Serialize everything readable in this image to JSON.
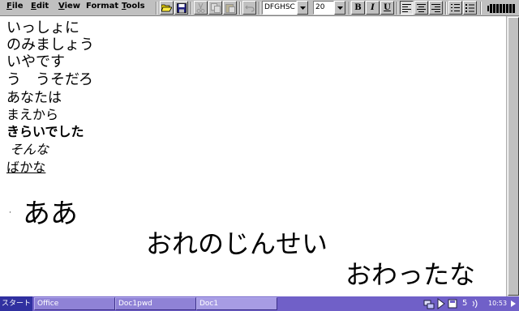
{
  "menu": {
    "file": {
      "first": "F",
      "rest": "ile"
    },
    "edit": {
      "first": "E",
      "rest": "dit"
    },
    "view": {
      "first": "V",
      "rest": "iew"
    },
    "format": {
      "first": "F",
      "rest": "ormat",
      "pre": "o"
    },
    "tools": {
      "first": "T",
      "rest": "ools"
    }
  },
  "toolbar": {
    "font_name": "DFGHSC",
    "font_size": "20",
    "bold_label": "B",
    "italic_label": "I",
    "underline_label": "U",
    "icons": [
      "open-folder-icon",
      "save-disk-icon",
      "cut-icon",
      "copy-icon",
      "paste-icon",
      "undo-icon",
      "align-left-icon",
      "align-center-icon",
      "align-right-icon",
      "numbered-list-icon",
      "bulleted-list-icon",
      "battery-icon"
    ]
  },
  "document": {
    "lines": [
      "いっしょに",
      "のみましょう",
      "いやです",
      "う　うそだろ",
      "あなたは",
      "まえから",
      "きらいでした",
      "そんな",
      "ばかな",
      "ああ",
      "おれのじんせい",
      "おわったな"
    ],
    "bullet": "·"
  },
  "taskbar": {
    "start_label": "スタート",
    "tasks": [
      "Office",
      "Doc1pwd",
      "Doc1"
    ],
    "tray_number": "5",
    "clock": "10:53"
  },
  "colors": {
    "toolbar": "#c0c0c0",
    "taskbar": "#7060c8",
    "start": "#3030a0"
  }
}
